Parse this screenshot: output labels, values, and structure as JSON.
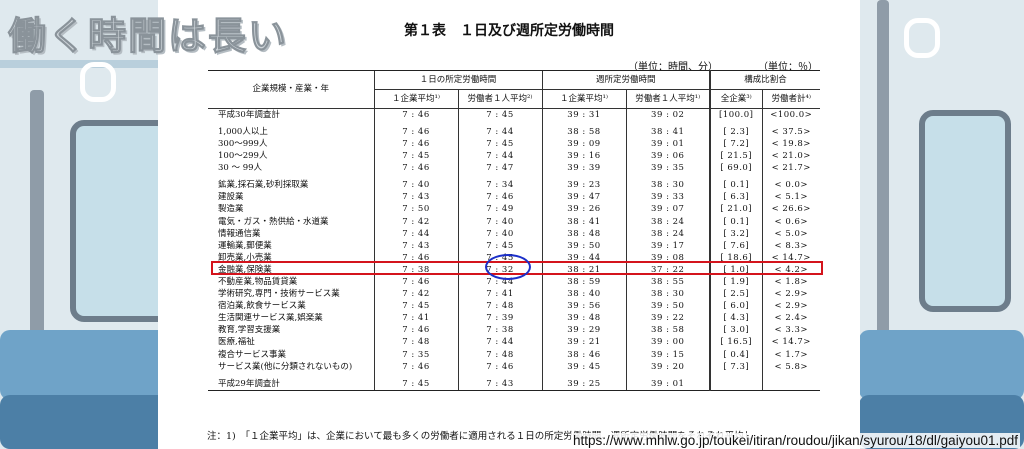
{
  "overlay_title": "働く時間は長い",
  "doc": {
    "title": "第１表　１日及び週所定労働時間",
    "unit_left": "（単位：時間、分）",
    "unit_right": "（単位：％）",
    "headers": {
      "row_label": "企業規模・産業・年",
      "group_daily": "１日の所定労働時間",
      "group_weekly": "週所定労働時間",
      "group_ratio": "構成比割合",
      "daily_company": "１企業平均¹⁾",
      "daily_worker": "労働者１人平均²⁾",
      "weekly_company": "１企業平均¹⁾",
      "weekly_worker": "労働者１人平均¹⁾",
      "ratio_all": "全企業³⁾",
      "ratio_workers": "労働者計⁴⁾"
    },
    "rows": [
      {
        "label": "平成30年調査計",
        "d1": "7 : 46",
        "d2": "7 : 45",
        "w1": "39 : 31",
        "w2": "39 : 02",
        "r1": "[100.0]",
        "r2": "<100.0>"
      },
      {
        "gap": true
      },
      {
        "label": "1,000人以上",
        "d1": "7 : 46",
        "d2": "7 : 44",
        "w1": "38 : 58",
        "w2": "38 : 41",
        "r1": "[ 2.3]",
        "r2": "< 37.5>"
      },
      {
        "label": "300～999人",
        "d1": "7 : 46",
        "d2": "7 : 45",
        "w1": "39 : 09",
        "w2": "39 : 01",
        "r1": "[ 7.2]",
        "r2": "< 19.8>"
      },
      {
        "label": "100～299人",
        "d1": "7 : 45",
        "d2": "7 : 44",
        "w1": "39 : 16",
        "w2": "39 : 06",
        "r1": "[ 21.5]",
        "r2": "< 21.0>"
      },
      {
        "label": "30 ～ 99人",
        "d1": "7 : 46",
        "d2": "7 : 47",
        "w1": "39 : 39",
        "w2": "39 : 35",
        "r1": "[ 69.0]",
        "r2": "< 21.7>"
      },
      {
        "gap": true
      },
      {
        "label": "鉱業,採石業,砂利採取業",
        "d1": "7 : 40",
        "d2": "7 : 34",
        "w1": "39 : 23",
        "w2": "38 : 30",
        "r1": "[ 0.1]",
        "r2": "< 0.0>"
      },
      {
        "label": "建設業",
        "d1": "7 : 43",
        "d2": "7 : 46",
        "w1": "39 : 47",
        "w2": "39 : 33",
        "r1": "[ 6.3]",
        "r2": "< 5.1>"
      },
      {
        "label": "製造業",
        "d1": "7 : 50",
        "d2": "7 : 49",
        "w1": "39 : 26",
        "w2": "39 : 07",
        "r1": "[ 21.0]",
        "r2": "< 26.6>"
      },
      {
        "label": "電気・ガス・熱供給・水道業",
        "d1": "7 : 42",
        "d2": "7 : 40",
        "w1": "38 : 41",
        "w2": "38 : 24",
        "r1": "[ 0.1]",
        "r2": "< 0.6>"
      },
      {
        "label": "情報通信業",
        "d1": "7 : 44",
        "d2": "7 : 40",
        "w1": "38 : 48",
        "w2": "38 : 24",
        "r1": "[ 3.2]",
        "r2": "< 5.0>"
      },
      {
        "label": "運輸業,郵便業",
        "d1": "7 : 43",
        "d2": "7 : 45",
        "w1": "39 : 50",
        "w2": "39 : 17",
        "r1": "[ 7.6]",
        "r2": "< 8.3>"
      },
      {
        "label": "卸売業,小売業",
        "d1": "7 : 46",
        "d2": "7 : 45",
        "w1": "39 : 44",
        "w2": "39 : 08",
        "r1": "[ 18.6]",
        "r2": "< 14.7>"
      },
      {
        "label": "金融業,保険業",
        "d1": "7 : 38",
        "d2": "7 : 32",
        "w1": "38 : 21",
        "w2": "37 : 22",
        "r1": "[ 1.0]",
        "r2": "< 4.2>"
      },
      {
        "label": "不動産業,物品賃貸業",
        "d1": "7 : 46",
        "d2": "7 : 44",
        "w1": "38 : 59",
        "w2": "38 : 55",
        "r1": "[ 1.9]",
        "r2": "< 1.8>"
      },
      {
        "label": "学術研究,専門・技術サービス業",
        "d1": "7 : 42",
        "d2": "7 : 41",
        "w1": "38 : 40",
        "w2": "38 : 30",
        "r1": "[ 2.5]",
        "r2": "< 2.9>"
      },
      {
        "label": "宿泊業,飲食サービス業",
        "d1": "7 : 45",
        "d2": "7 : 48",
        "w1": "39 : 56",
        "w2": "39 : 50",
        "r1": "[ 6.0]",
        "r2": "< 2.9>"
      },
      {
        "label": "生活関連サービス業,娯楽業",
        "d1": "7 : 41",
        "d2": "7 : 39",
        "w1": "39 : 48",
        "w2": "39 : 22",
        "r1": "[ 4.3]",
        "r2": "< 2.4>"
      },
      {
        "label": "教育,学習支援業",
        "d1": "7 : 46",
        "d2": "7 : 38",
        "w1": "39 : 29",
        "w2": "38 : 58",
        "r1": "[ 3.0]",
        "r2": "< 3.3>"
      },
      {
        "label": "医療,福祉",
        "d1": "7 : 48",
        "d2": "7 : 44",
        "w1": "39 : 21",
        "w2": "39 : 00",
        "r1": "[ 16.5]",
        "r2": "< 14.7>"
      },
      {
        "label": "複合サービス事業",
        "d1": "7 : 35",
        "d2": "7 : 48",
        "w1": "38 : 46",
        "w2": "39 : 15",
        "r1": "[ 0.4]",
        "r2": "< 1.7>"
      },
      {
        "label": "サービス業(他に分類されないもの)",
        "d1": "7 : 46",
        "d2": "7 : 46",
        "w1": "39 : 45",
        "w2": "39 : 20",
        "r1": "[ 7.3]",
        "r2": "< 5.8>"
      },
      {
        "gap": true
      },
      {
        "label": "平成29年調査計",
        "d1": "7 : 45",
        "d2": "7 : 43",
        "w1": "39 : 25",
        "w2": "39 : 01",
        "r1": "",
        "r2": ""
      }
    ],
    "note": "注：1)　「１企業平均」は、企業において最も多くの労働者に適用される１日の所定労働時間、週所定労働時間をそれぞれ平均し"
  },
  "source_url": "https://www.mhlw.go.jp/toukei/itiran/roudou/jikan/syurou/18/dl/gaiyou01.pdf",
  "colors": {
    "highlight_rect": "#d4141c",
    "highlight_circle": "#1b2fc9"
  }
}
